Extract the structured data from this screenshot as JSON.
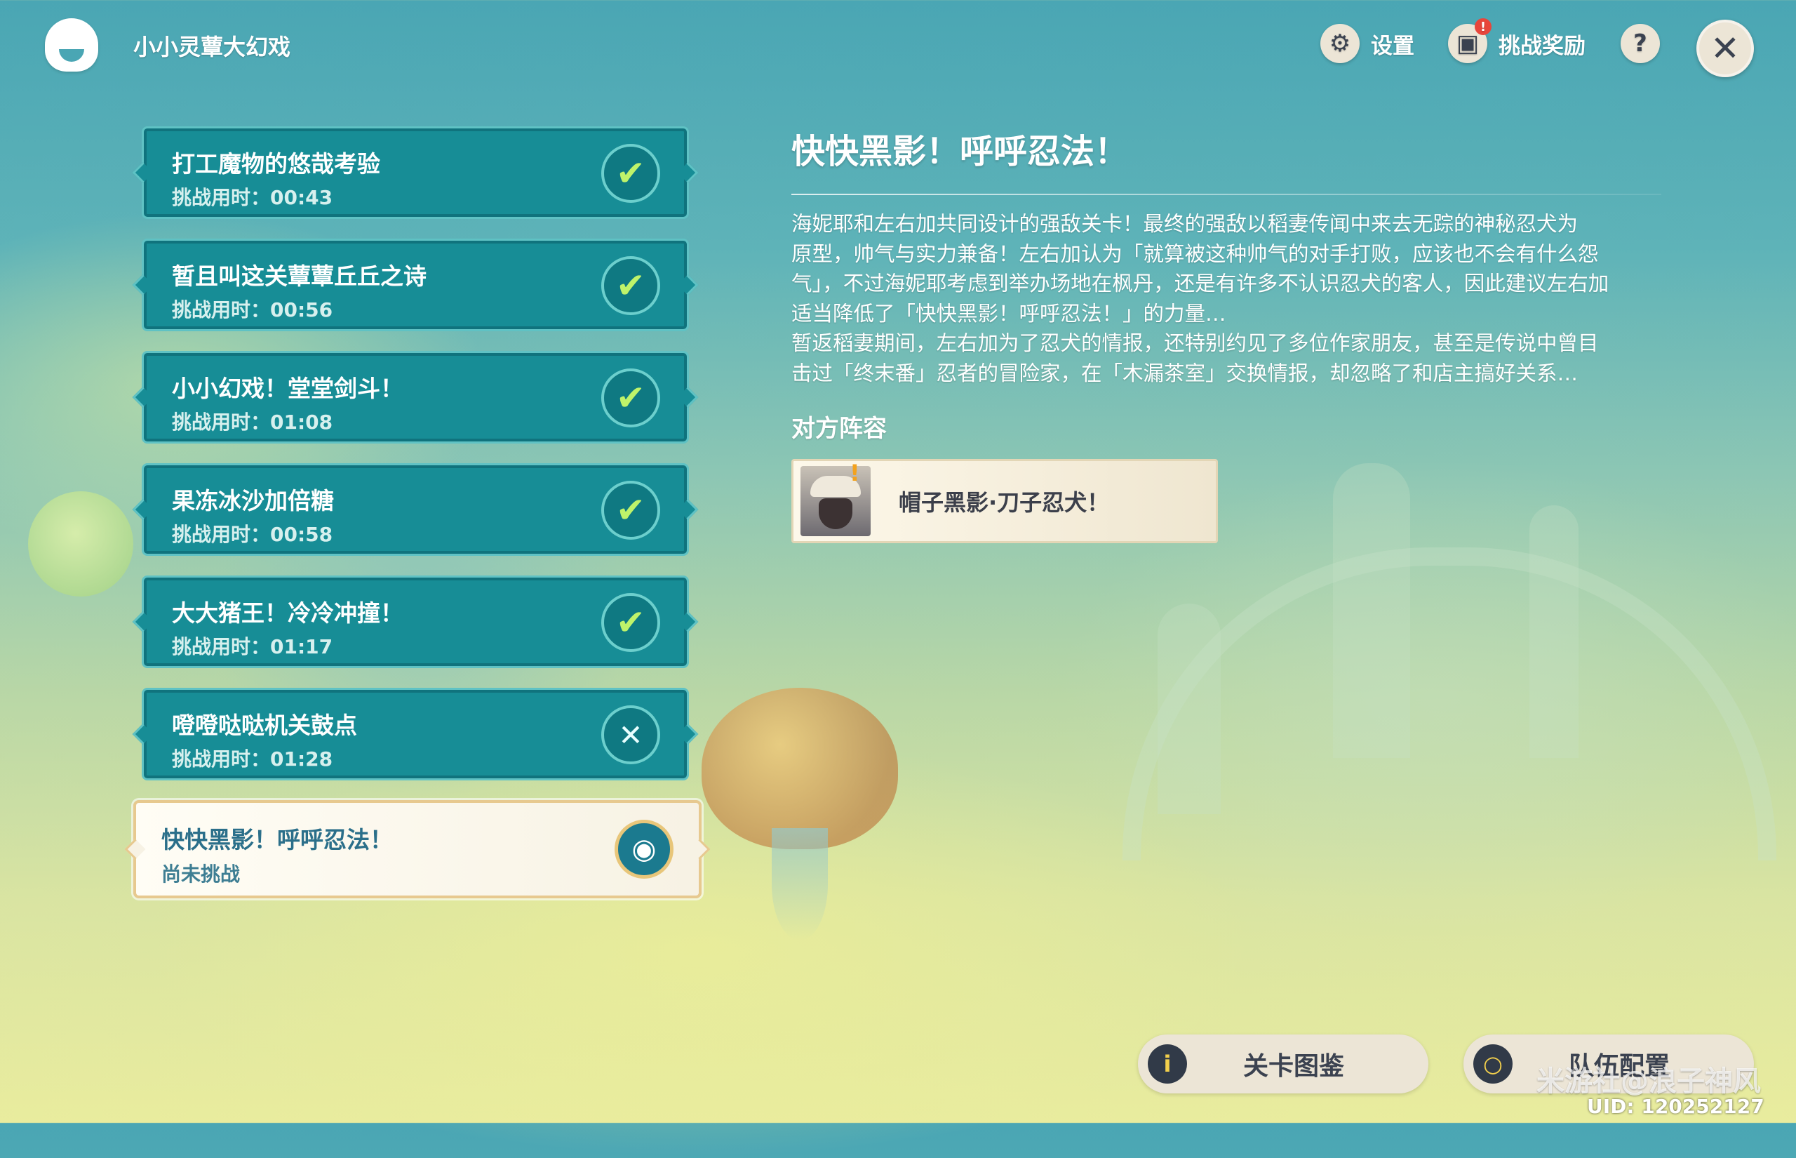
{
  "header": {
    "title": "小小灵蕈大幻戏",
    "settings_label": "设置",
    "rewards_label": "挑战奖励",
    "rewards_badge": "!",
    "help_icon": "?",
    "close_icon": "✕"
  },
  "stages": [
    {
      "name": "打工魔物的悠哉考验",
      "time": "挑战用时：00:43",
      "status": "cleared",
      "icon": "✔"
    },
    {
      "name": "暂且叫这关蕈蕈丘丘之诗",
      "time": "挑战用时：00:56",
      "status": "cleared",
      "icon": "✔"
    },
    {
      "name": "小小幻戏！堂堂剑斗！",
      "time": "挑战用时：01:08",
      "status": "cleared",
      "icon": "✔"
    },
    {
      "name": "果冻冰沙加倍糖",
      "time": "挑战用时：00:58",
      "status": "cleared",
      "icon": "✔"
    },
    {
      "name": "大大猪王！冷冷冲撞！",
      "time": "挑战用时：01:17",
      "status": "cleared",
      "icon": "✔"
    },
    {
      "name": "噔噔哒哒机关鼓点",
      "time": "挑战用时：01:28",
      "status": "cleared",
      "icon": "✕"
    },
    {
      "name": "快快黑影！呼呼忍法！",
      "time": "尚未挑战",
      "status": "selected",
      "icon": "◉"
    }
  ],
  "detail": {
    "title": "快快黑影！呼呼忍法！",
    "description": "海妮耶和左右加共同设计的强敌关卡！最终的强敌以稻妻传闻中来去无踪的神秘忍犬为\n原型，帅气与实力兼备！左右加认为「就算被这种帅气的对手打败，应该也不会有什么怨\n气」，不过海妮耶考虑到举办场地在枫丹，还是有许多不认识忍犬的客人，因此建议左右加\n适当降低了「快快黑影！呼呼忍法！」的力量…\n暂返稻妻期间，左右加为了忍犬的情报，还特别约见了多位作家朋友，甚至是传说中曾目\n击过「终末番」忍者的冒险家，在「木漏茶室」交换情报，却忽略了和店主搞好关系…",
    "enemy_section": "对方阵容",
    "enemy_name": "帽子黑影·刀子忍犬！",
    "enemy_warning": "!"
  },
  "bottom": {
    "catalog_label": "关卡图鉴",
    "catalog_icon": "i",
    "team_label": "队伍配置",
    "team_icon": "○"
  },
  "overlay": {
    "watermark": "米游社@浪子神风",
    "uid": "UID: 120252127"
  },
  "colors": {
    "stage_bg": "#178d96",
    "stage_border": "#5fc2c4",
    "check": "#bff36a",
    "selected_bg": "#f7f2e4",
    "selected_border": "#e7c98f",
    "button_bg": "#ece5d6"
  }
}
